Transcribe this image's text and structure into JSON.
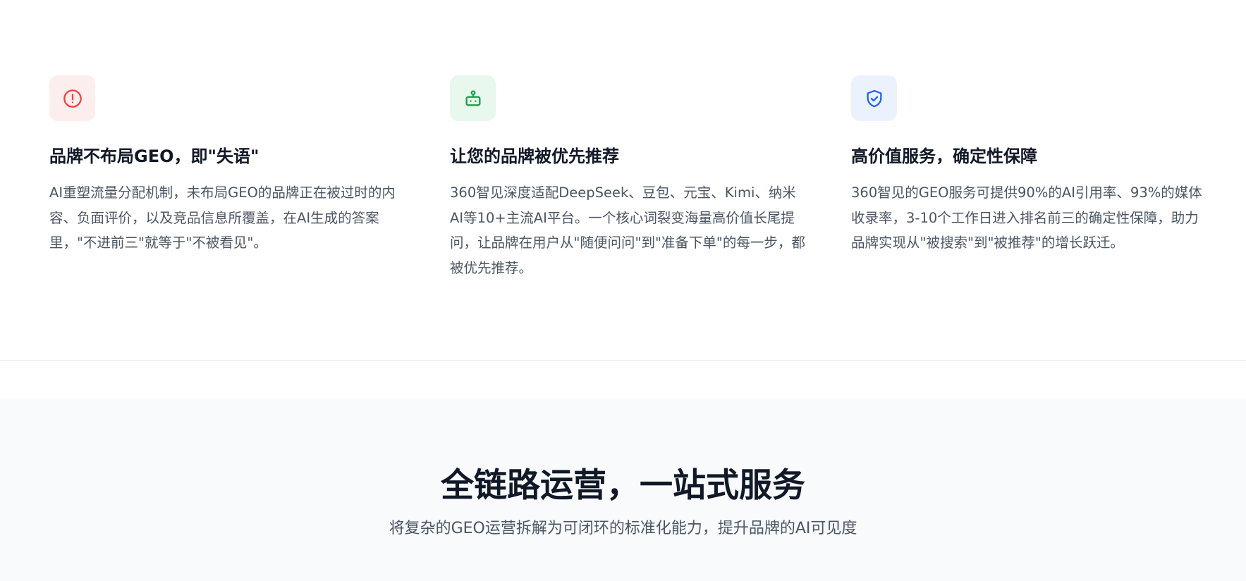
{
  "features": [
    {
      "icon": "alert-circle-icon",
      "accent": "#ef4444",
      "title": "品牌不布局GEO，即\"失语\"",
      "description": "AI重塑流量分配机制，未布局GEO的品牌正在被过时的内容、负面评价，以及竞品信息所覆盖，在AI生成的答案里，\"不进前三\"就等于\"不被看见\"。"
    },
    {
      "icon": "robot-icon",
      "accent": "#16a34a",
      "title": "让您的品牌被优先推荐",
      "description": "360智见深度适配DeepSeek、豆包、元宝、Kimi、纳米AI等10+主流AI平台。一个核心词裂变海量高价值长尾提问，让品牌在用户从\"随便问问\"到\"准备下单\"的每一步，都被优先推荐。"
    },
    {
      "icon": "shield-check-icon",
      "accent": "#2563eb",
      "title": "高价值服务，确定性保障",
      "description": "360智见的GEO服务可提供90%的AI引用率、93%的媒体收录率，3-10个工作日进入排名前三的确定性保障，助力品牌实现从\"被搜索\"到\"被推荐\"的增长跃迁。"
    }
  ],
  "services": {
    "title": "全链路运营，一站式服务",
    "subtitle": "将复杂的GEO运营拆解为可闭环的标准化能力，提升品牌的AI可见度"
  }
}
